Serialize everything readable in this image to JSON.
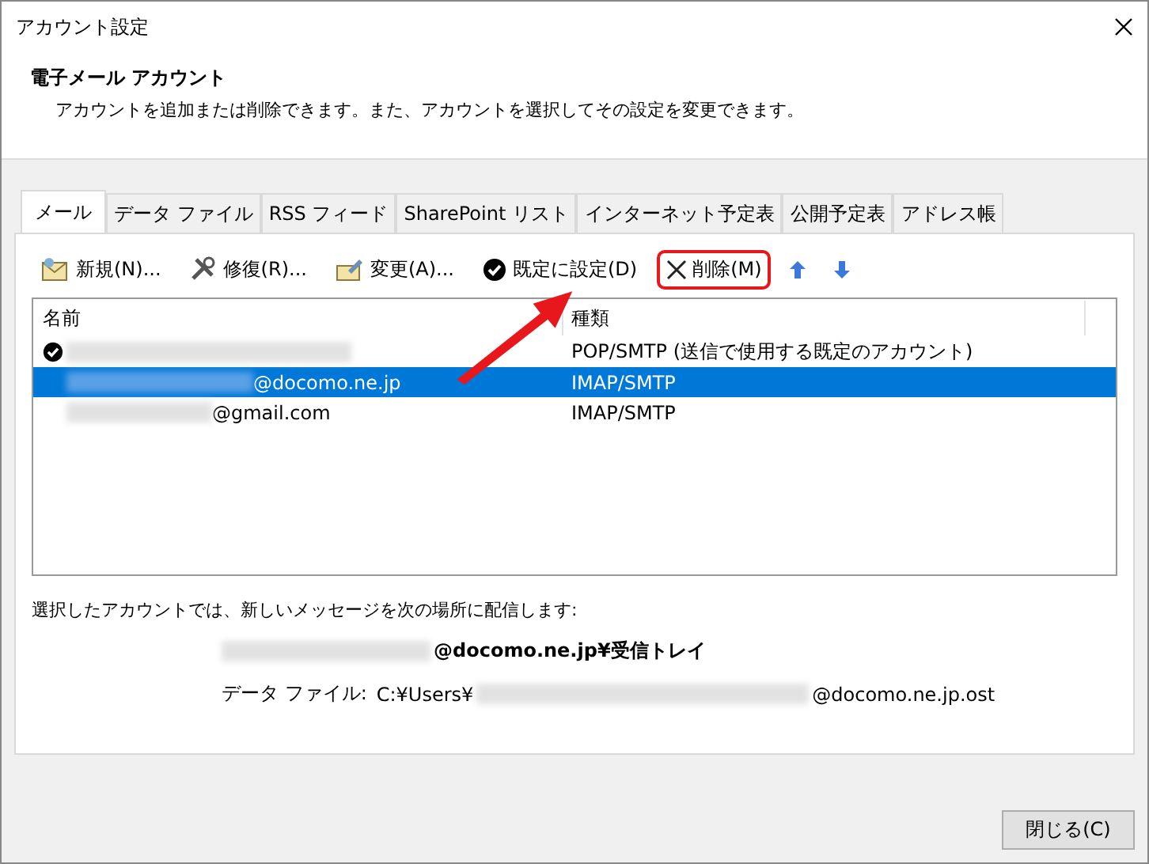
{
  "window": {
    "title": "アカウント設定"
  },
  "header": {
    "title": "電子メール アカウント",
    "description": "アカウントを追加または削除できます。また、アカウントを選択してその設定を変更できます。"
  },
  "tabs": [
    {
      "label": "メール",
      "selected": true
    },
    {
      "label": "データ ファイル",
      "selected": false
    },
    {
      "label": "RSS フィード",
      "selected": false
    },
    {
      "label": "SharePoint リスト",
      "selected": false
    },
    {
      "label": "インターネット予定表",
      "selected": false
    },
    {
      "label": "公開予定表",
      "selected": false
    },
    {
      "label": "アドレス帳",
      "selected": false
    }
  ],
  "toolbar": [
    {
      "kind": "new",
      "label": "新規(N)...",
      "highlighted": false
    },
    {
      "kind": "repair",
      "label": "修復(R)...",
      "highlighted": false
    },
    {
      "kind": "change",
      "label": "変更(A)...",
      "highlighted": false
    },
    {
      "kind": "default",
      "label": "既定に設定(D)",
      "highlighted": false
    },
    {
      "kind": "delete",
      "label": "削除(M)",
      "highlighted": true
    },
    {
      "kind": "up"
    },
    {
      "kind": "down"
    }
  ],
  "table": {
    "columns": [
      "名前",
      "種類"
    ],
    "rows": [
      {
        "type": "POP/SMTP (送信で使用する既定のアカウント)",
        "default": true,
        "selected": false
      },
      {
        "name": "@docomo.ne.jp",
        "type": "IMAP/SMTP",
        "default": false,
        "selected": true
      },
      {
        "name": "@gmail.com",
        "type": "IMAP/SMTP",
        "default": false,
        "selected": false
      }
    ]
  },
  "delivery": {
    "label": "選択したアカウントでは、新しいメッセージを次の場所に配信します:",
    "folder": "@docomo.ne.jp¥受信トレイ",
    "data_file_label": "データ ファイル:",
    "path_prefix": "C:¥Users¥",
    "path_suffix": "@docomo.ne.jp.ost"
  },
  "buttons": [
    "閉じる(C)"
  ]
}
